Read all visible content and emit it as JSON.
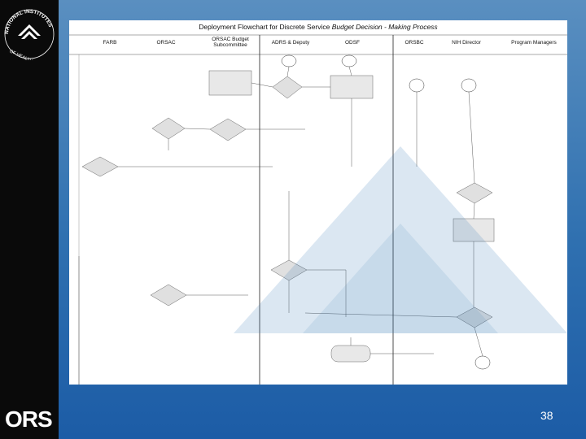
{
  "slide": {
    "page_number": "38",
    "org_logo_text": "NATIONAL INSTITUTES OF HEALTH",
    "ors_logo": "ORS"
  },
  "diagram": {
    "title_main": "Deployment Flowchart for Discrete Service",
    "title_italic": "Budget Decision - Making Process",
    "lanes": [
      {
        "label": "FARB"
      },
      {
        "label": "ORSAC"
      },
      {
        "label": "ORSAC Budget Subcommittee"
      },
      {
        "label": "ADRS & Deputy"
      },
      {
        "label": "ODSF"
      },
      {
        "label": "ORSBC"
      },
      {
        "label": "NIH Director"
      },
      {
        "label": "Program Managers"
      }
    ]
  },
  "colors": {
    "left_bar": "#0a0a0a",
    "background_top": "#5a8fc0",
    "background_bottom": "#1c5ca6",
    "sheet": "#ffffff"
  }
}
